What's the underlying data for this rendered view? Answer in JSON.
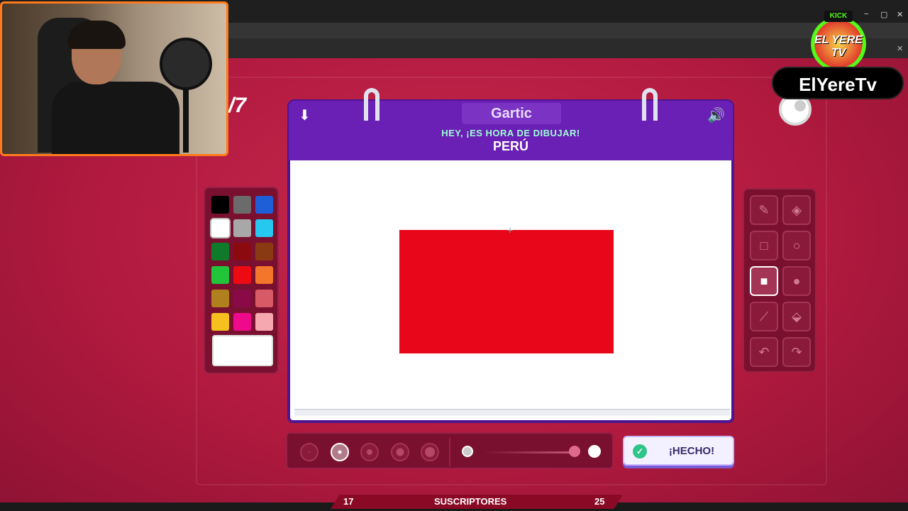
{
  "browser": {
    "window_controls": [
      "−",
      "▢",
      "✕"
    ],
    "close_tab": "✕"
  },
  "game": {
    "round_counter": "/7",
    "header": {
      "logo": "Gartic",
      "subtitle": "HEY, ¡ES HORA DE DIBUJAR!",
      "word": "PERÚ"
    },
    "palette": {
      "colors": [
        "#000000",
        "#6b6b6b",
        "#1e5fd8",
        "#ffffff",
        "#a8a8a8",
        "#27c8f0",
        "#0f7a2a",
        "#8a0a10",
        "#8a3a12",
        "#22c43a",
        "#ee0a12",
        "#f3762a",
        "#b0801e",
        "#8a0a48",
        "#d85a66",
        "#f6c01e",
        "#ee0a8a",
        "#f6a8b0"
      ],
      "selected_color": "#ffffff"
    },
    "tools": [
      {
        "name": "pencil",
        "glyph": "✎",
        "active": false
      },
      {
        "name": "eraser",
        "glyph": "◈",
        "active": false
      },
      {
        "name": "rectangle-outline",
        "glyph": "□",
        "active": false
      },
      {
        "name": "circle-outline",
        "glyph": "○",
        "active": false
      },
      {
        "name": "rectangle-filled",
        "glyph": "■",
        "active": true
      },
      {
        "name": "circle-filled",
        "glyph": "●",
        "active": false
      },
      {
        "name": "line",
        "glyph": "⟋",
        "active": false
      },
      {
        "name": "fill-bucket",
        "glyph": "⬙",
        "active": false
      },
      {
        "name": "undo",
        "glyph": "↶",
        "active": false
      },
      {
        "name": "redo",
        "glyph": "↷",
        "active": false
      }
    ],
    "brush_sizes": 5,
    "selected_brush_size": 2,
    "opacity_level": 0.9,
    "done_label": "¡HECHO!",
    "drawing": {
      "fill_color": "#e8071a"
    }
  },
  "overlay": {
    "subs_left": "17",
    "subs_label": "SUSCRIPTORES",
    "subs_right": "25",
    "kick_label": "KICK",
    "logo_text": "EL YERE TV",
    "channel_name": "ElYereTv"
  }
}
